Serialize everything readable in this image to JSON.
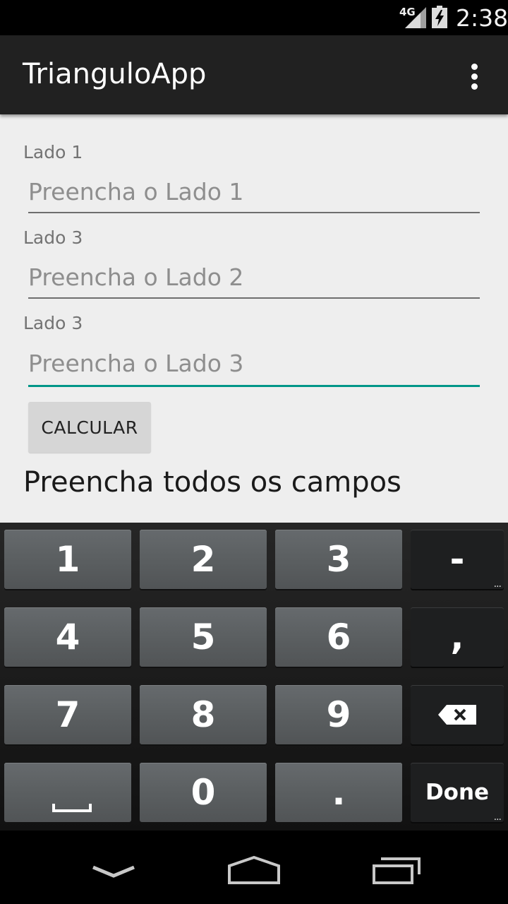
{
  "status_bar": {
    "network": "4G",
    "time": "2:38"
  },
  "app_bar": {
    "title": "TrianguloApp"
  },
  "form": {
    "fields": [
      {
        "label": "Lado 1",
        "placeholder": "Preencha o Lado 1",
        "value": ""
      },
      {
        "label": "Lado 3",
        "placeholder": "Preencha o Lado 2",
        "value": ""
      },
      {
        "label": "Lado 3",
        "placeholder": "Preencha o Lado 3",
        "value": ""
      }
    ],
    "button_label": "CALCULAR",
    "result_text": "Preencha todos os campos"
  },
  "keyboard": {
    "rows": [
      [
        "1",
        "2",
        "3",
        "-"
      ],
      [
        "4",
        "5",
        "6",
        ","
      ],
      [
        "7",
        "8",
        "9",
        "backspace-icon"
      ],
      [
        "space-icon",
        "0",
        ".",
        "Done"
      ]
    ],
    "done_label": "Done"
  },
  "colors": {
    "accent": "#009688",
    "app_bar": "#212121",
    "content_bg": "#eeeeee"
  }
}
